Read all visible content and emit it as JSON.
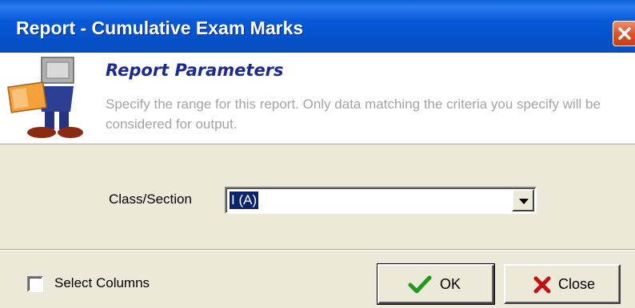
{
  "window": {
    "title": "Report - Cumulative Exam Marks"
  },
  "header": {
    "title": "Report Parameters",
    "description": "Specify the range for this report. Only data matching the criteria you specify will be considered for output."
  },
  "form": {
    "class_section_label": "Class/Section",
    "class_section_value": "I (A)"
  },
  "footer": {
    "select_columns_label": "Select Columns",
    "select_columns_checked": false,
    "ok_label": "OK",
    "close_label": "Close"
  },
  "icons": {
    "title_close": "close-x-icon",
    "mascot": "reading-mascot-icon",
    "dropdown": "chevron-down-icon",
    "ok": "checkmark-icon",
    "close": "red-x-icon"
  },
  "colors": {
    "title_bar": "#0758d8",
    "header_title": "#1c2a8c",
    "selection": "#0a246a",
    "checkmark": "#1f9a1f",
    "close_x": "#c41010"
  }
}
